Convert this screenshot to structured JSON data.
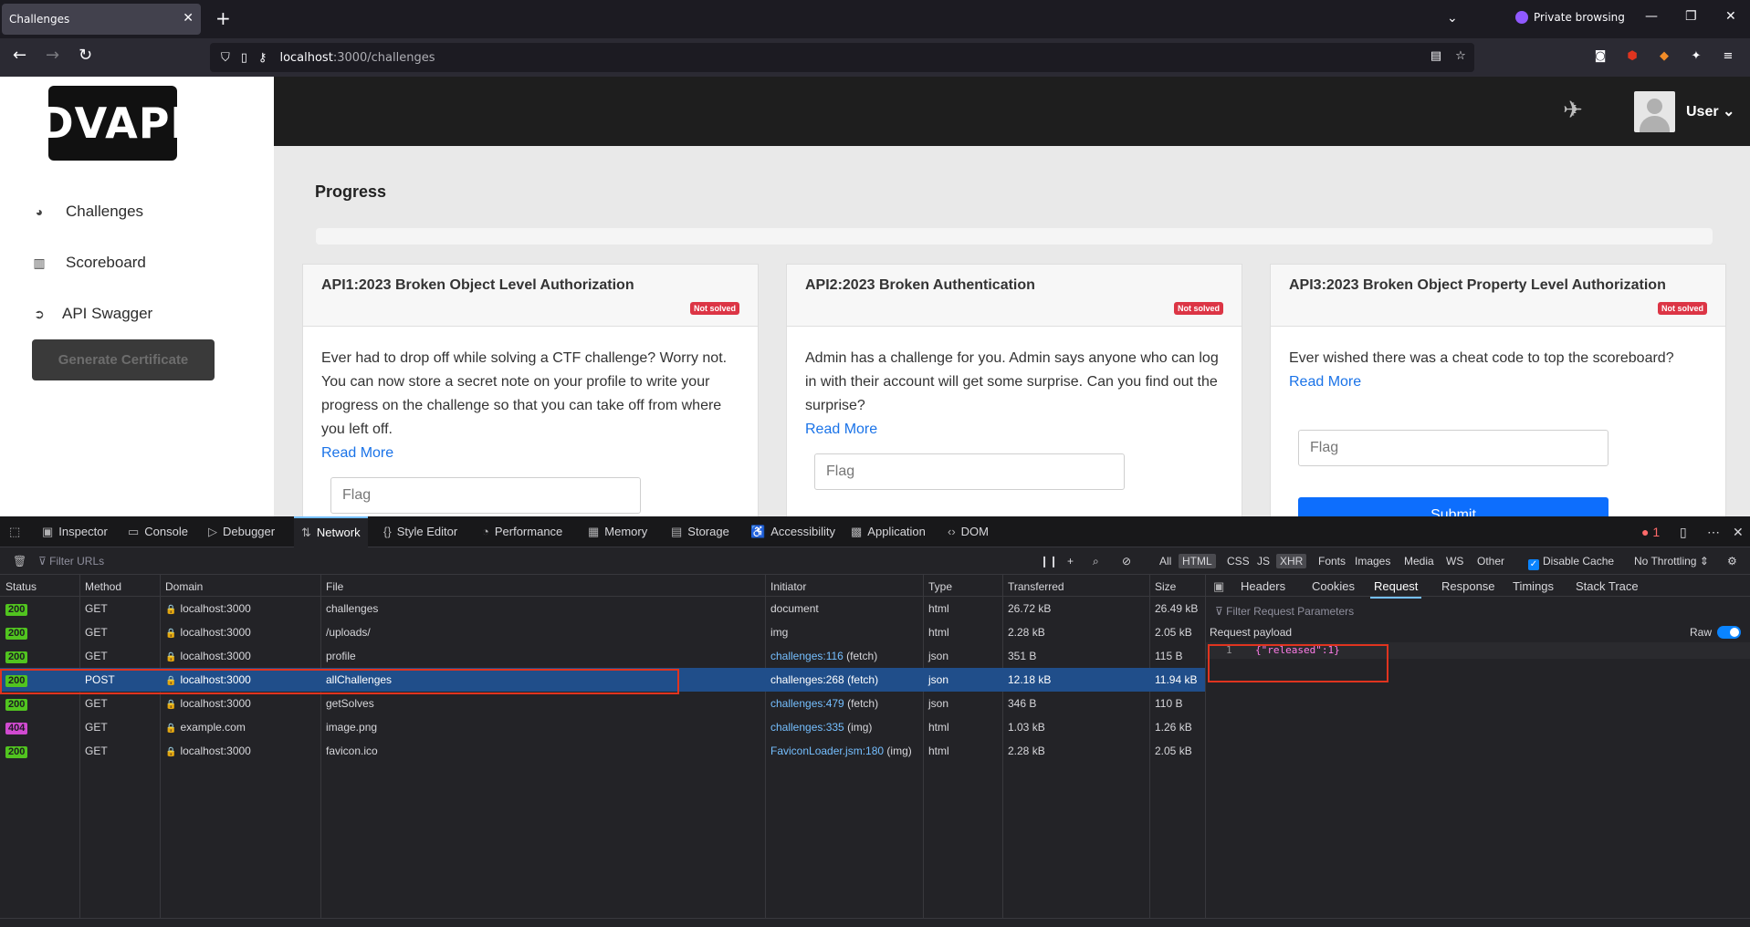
{
  "browser": {
    "tab_title": "Challenges",
    "tab_close": "✕",
    "new_tab": "+",
    "private_label": "Private browsing",
    "url_host": "localhost",
    "url_path": ":3000/challenges",
    "accent": "#9059ff"
  },
  "sidebar": {
    "logo": "DVAPI",
    "items": [
      {
        "label": "Challenges",
        "icon": "dashboard-icon"
      },
      {
        "label": "Scoreboard",
        "icon": "chart-icon"
      },
      {
        "label": "API Swagger",
        "icon": "arrow-circle-icon"
      }
    ],
    "generate_label": "Generate Certificate"
  },
  "header": {
    "user_label": "User ⌄"
  },
  "main": {
    "progress_title": "Progress",
    "cards": [
      {
        "title": "API1:2023 Broken Object Level Authorization",
        "badge": "Not solved",
        "text": "Ever had to drop off while solving a CTF challenge? Worry not. You can now store a secret note on your profile to write your progress on the challenge so that you can take off from where you left off.",
        "read_more": "Read More",
        "flag_placeholder": "Flag"
      },
      {
        "title": "API2:2023 Broken Authentication",
        "badge": "Not solved",
        "text": "Admin has a challenge for you. Admin says anyone who can log in with their account will get some surprise. Can you find out the surprise?",
        "read_more": "Read More",
        "flag_placeholder": "Flag"
      },
      {
        "title": "API3:2023 Broken Object Property Level Authorization",
        "badge": "Not solved",
        "text": "Ever wished there was a cheat code to top the scoreboard?",
        "read_more": "Read More",
        "flag_placeholder": "Flag",
        "submit": "Submit"
      }
    ]
  },
  "devtools": {
    "tabs": [
      "Inspector",
      "Console",
      "Debugger",
      "Network",
      "Style Editor",
      "Performance",
      "Memory",
      "Storage",
      "Accessibility",
      "Application",
      "DOM"
    ],
    "active_tab": "Network",
    "error_count": "1",
    "filter_placeholder": "Filter URLs",
    "type_filters": [
      "All",
      "HTML",
      "CSS",
      "JS",
      "XHR",
      "Fonts",
      "Images",
      "Media",
      "WS",
      "Other"
    ],
    "disable_cache": "Disable Cache",
    "throttling": "No Throttling ⇕",
    "columns": [
      "Status",
      "Method",
      "Domain",
      "File",
      "Initiator",
      "Type",
      "Transferred",
      "Size"
    ],
    "rows": [
      {
        "status": "200",
        "method": "GET",
        "domain": "localhost:3000",
        "file": "challenges",
        "initiator_link": "document",
        "initiator_extra": "",
        "type": "html",
        "transferred": "26.72 kB",
        "size": "26.49 kB"
      },
      {
        "status": "200",
        "method": "GET",
        "domain": "localhost:3000",
        "file": "/uploads/",
        "initiator_link": "img",
        "initiator_extra": "",
        "type": "html",
        "transferred": "2.28 kB",
        "size": "2.05 kB"
      },
      {
        "status": "200",
        "method": "GET",
        "domain": "localhost:3000",
        "file": "profile",
        "initiator_link": "challenges:116",
        "initiator_extra": " (fetch)",
        "type": "json",
        "transferred": "351 B",
        "size": "115 B"
      },
      {
        "status": "200",
        "method": "POST",
        "domain": "localhost:3000",
        "file": "allChallenges",
        "initiator_link": "challenges:268",
        "initiator_extra": " (fetch)",
        "type": "json",
        "transferred": "12.18 kB",
        "size": "11.94 kB"
      },
      {
        "status": "200",
        "method": "GET",
        "domain": "localhost:3000",
        "file": "getSolves",
        "initiator_link": "challenges:479",
        "initiator_extra": " (fetch)",
        "type": "json",
        "transferred": "346 B",
        "size": "110 B"
      },
      {
        "status": "404",
        "method": "GET",
        "domain": "example.com",
        "file": "image.png",
        "initiator_link": "challenges:335",
        "initiator_extra": " (img)",
        "type": "html",
        "transferred": "1.03 kB",
        "size": "1.26 kB"
      },
      {
        "status": "200",
        "method": "GET",
        "domain": "localhost:3000",
        "file": "favicon.ico",
        "initiator_link": "FaviconLoader.jsm:180",
        "initiator_extra": " (img)",
        "type": "html",
        "transferred": "2.28 kB",
        "size": "2.05 kB"
      }
    ],
    "side_tabs": [
      "Headers",
      "Cookies",
      "Request",
      "Response",
      "Timings",
      "Stack Trace"
    ],
    "side_active": "Request",
    "side_filter": "Filter Request Parameters",
    "payload_label": "Request payload",
    "raw_label": "Raw",
    "payload_line_no": "1",
    "payload": "{\"released\":1}"
  }
}
